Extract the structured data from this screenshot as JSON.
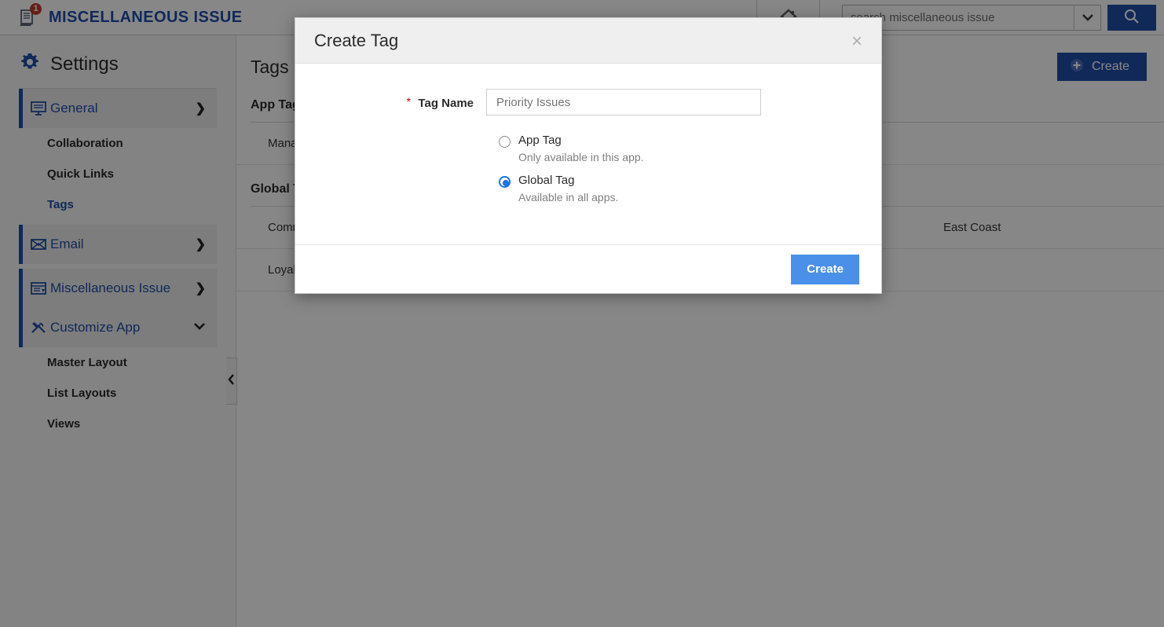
{
  "topbar": {
    "app_name": "MISCELLANEOUS ISSUE",
    "notification_count": "1",
    "doc_icon": "document-icon",
    "home_icon": "home-icon",
    "search": {
      "placeholder": "search miscellaneous issue",
      "value": "",
      "caret_icon": "chevron-down-icon",
      "button_icon": "search-icon"
    }
  },
  "sidebar": {
    "title": "Settings",
    "gear_icon": "gear-icon",
    "collapse_icon": "chevron-left-icon",
    "nav": [
      {
        "label": "General",
        "icon": "monitor-icon",
        "chevron": "❯",
        "type": "main"
      },
      {
        "label": "Collaboration",
        "type": "sub",
        "active": false
      },
      {
        "label": "Quick Links",
        "type": "sub",
        "active": false
      },
      {
        "label": "Tags",
        "type": "sub",
        "active": true
      },
      {
        "label": "Email",
        "icon": "envelope-icon",
        "chevron": "❯",
        "type": "main"
      },
      {
        "label": "Miscellaneous Issue",
        "icon": "window-icon",
        "chevron": "❯",
        "type": "main"
      },
      {
        "label": "Customize App",
        "icon": "tools-icon",
        "chevron": "❯",
        "type": "main",
        "expanded": true
      },
      {
        "label": "Master Layout",
        "type": "sub",
        "active": false
      },
      {
        "label": "List Layouts",
        "type": "sub",
        "active": false
      },
      {
        "label": "Views",
        "type": "sub",
        "active": false
      }
    ]
  },
  "main": {
    "page_title": "Tags",
    "create_button": "Create",
    "create_icon": "plus-circle-icon",
    "sections": [
      {
        "heading": "App Tags",
        "rows": [
          {
            "name": "Management",
            "meta": ""
          }
        ]
      },
      {
        "heading": "Global Tags",
        "rows": [
          {
            "name": "Commercial",
            "meta": "East Coast"
          },
          {
            "name": "Loyalty",
            "meta": ""
          }
        ]
      }
    ]
  },
  "modal": {
    "title": "Create Tag",
    "close_icon": "close-icon",
    "field": {
      "label": "Tag Name",
      "required_marker": "*",
      "value": "",
      "placeholder": "Priority Issues"
    },
    "radios": [
      {
        "title": "App Tag",
        "desc": "Only available in this app.",
        "selected": false
      },
      {
        "title": "Global Tag",
        "desc": "Available in all apps.",
        "selected": true
      }
    ],
    "submit_label": "Create"
  },
  "colors": {
    "brand_blue": "#1f4fa8",
    "accent_blue": "#1a73e8",
    "primary_button": "#4a90e8",
    "badge_red": "#c0392b",
    "required_red": "#d0021b"
  }
}
